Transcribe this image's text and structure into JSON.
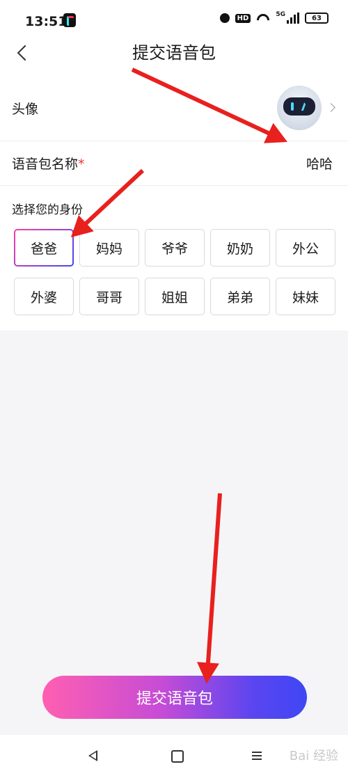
{
  "status_bar": {
    "time": "13:51",
    "hd": "HD",
    "network": "5G",
    "battery": "63"
  },
  "header": {
    "title": "提交语音包"
  },
  "form": {
    "avatar_label": "头像",
    "name_label": "语音包名称",
    "name_required": "*",
    "name_value": "哈哈",
    "identity_label": "选择您的身份",
    "identity_options": [
      "爸爸",
      "妈妈",
      "爷爷",
      "奶奶",
      "外公",
      "外婆",
      "哥哥",
      "姐姐",
      "弟弟",
      "妹妹"
    ],
    "selected_identity": "爸爸"
  },
  "submit_label": "提交语音包",
  "watermark": "Bai 经验",
  "icons": [
    "back-icon",
    "chevron-right-icon",
    "nav-back-icon",
    "nav-home-icon",
    "nav-menu-icon"
  ],
  "colors": {
    "accent_start": "#ff5fb1",
    "accent_end": "#3f47f5",
    "annotation_arrow": "#e8201e",
    "required": "#e53935"
  }
}
